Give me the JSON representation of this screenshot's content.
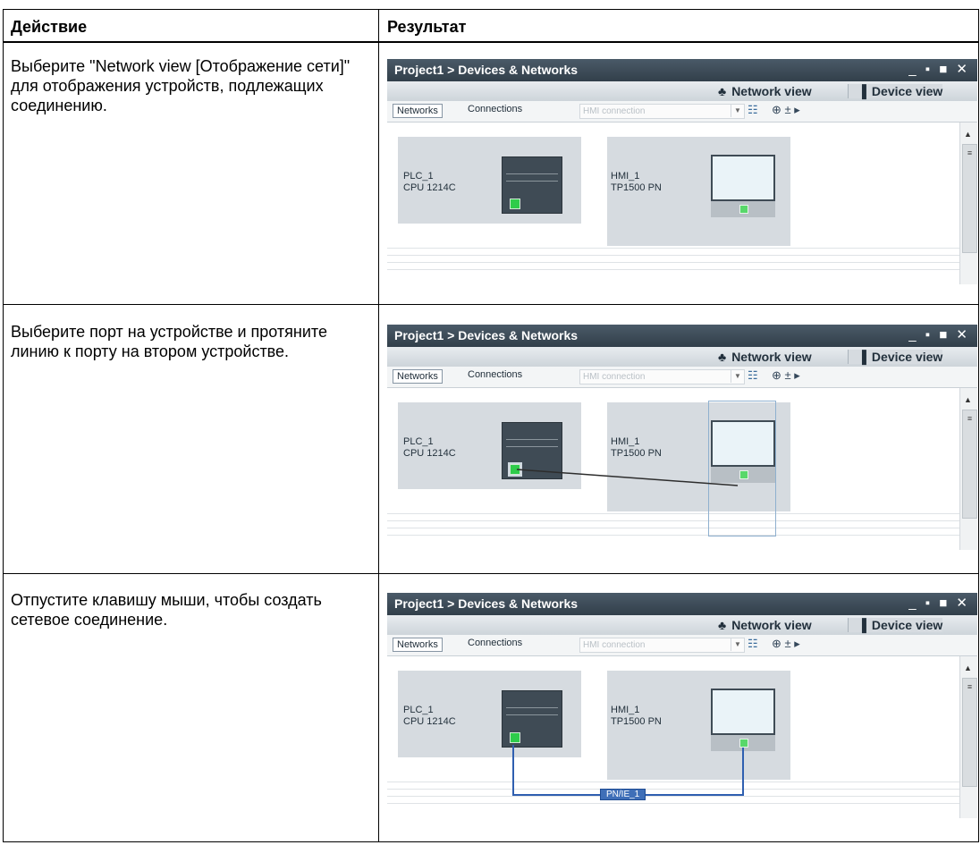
{
  "table": {
    "header_action": "Действие",
    "header_result": "Результат"
  },
  "rows": [
    {
      "action": "Выберите \"Network view [Отображение сети]\" для отображения устройств, подлежащих соединению."
    },
    {
      "action": "Выберите порт на устройстве и протяните линию к порту на втором устройстве."
    },
    {
      "action": "Отпустите клавишу мыши, чтобы создать сетевое соединение."
    }
  ],
  "screenshot": {
    "title": "Project1 > Devices & Networks",
    "window_buttons": "_ ▪ ■ ✕",
    "network_view_tab": "Network view",
    "device_view_tab": "Device view",
    "toolbar": {
      "networks_button": "Networks",
      "connections_button": "Connections",
      "connection_type_placeholder": "HMI connection",
      "zoom_label": "⊕ ± ▸"
    },
    "plc": {
      "name": "PLC_1",
      "type": "CPU 1214C"
    },
    "hmi": {
      "name": "HMI_1",
      "type": "TP1500 PN"
    },
    "network_label": "PN/IE_1"
  },
  "colors": {
    "titlebar": "#3b4955",
    "port_green": "#2ecc4a",
    "network_line": "#2f5fb0"
  }
}
